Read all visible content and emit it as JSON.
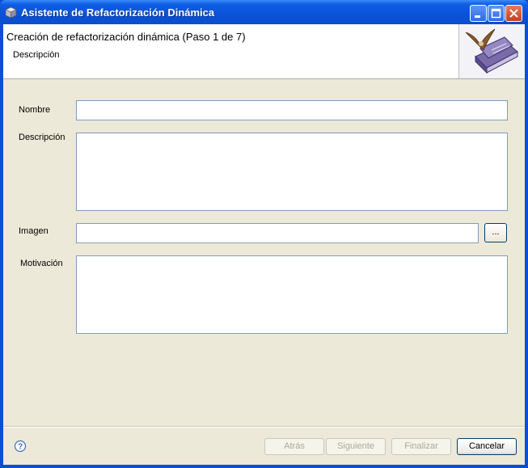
{
  "window": {
    "title": "Asistente de Refactorización Dinámica",
    "icons": [
      "app-icon",
      "minimize-icon",
      "maximize-icon",
      "close-icon"
    ]
  },
  "header": {
    "title": "Creación de refactorización dinámica (Paso 1 de 7)",
    "subtitle": "Descripción",
    "image": "eagle-books-icon"
  },
  "form": {
    "nombre_label": "Nombre",
    "nombre_value": "",
    "descripcion_label": "Descripción",
    "descripcion_value": "",
    "imagen_label": "Imagen",
    "imagen_value": "",
    "browse_label": "...",
    "motivacion_label": "Motivación",
    "motivacion_value": ""
  },
  "footer": {
    "help_icon": "help-icon",
    "back_label": "Atrás",
    "next_label": "Siguiente",
    "finish_label": "Finalizar",
    "cancel_label": "Cancelar"
  }
}
